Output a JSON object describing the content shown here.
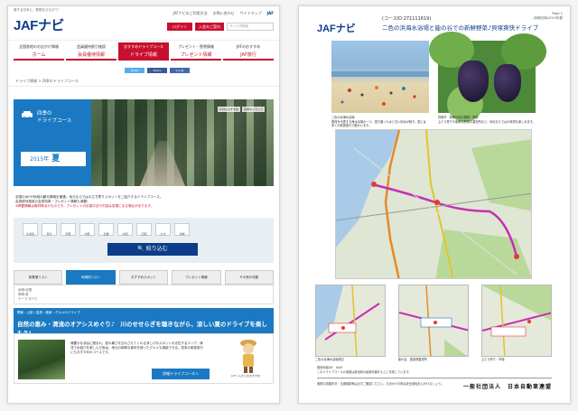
{
  "left": {
    "tagline": "旅する日本に、発見をひろげて!",
    "logo": "JAFナビ",
    "toplinks": [
      "JAFナビのご利用方法",
      "お問い合わせ",
      "サイトマップ",
      "JAF"
    ],
    "login": "ログイン",
    "member": "入会のご案内",
    "search_placeholder": "サイト内検索",
    "nav": [
      {
        "small": "全国各地のお出かけ情報",
        "big": "ホーム"
      },
      {
        "small": "会員優待割引施設",
        "big": "会員優待情報"
      },
      {
        "small": "おすすめドライブコース",
        "big": "ドライブ情報"
      },
      {
        "small": "プレゼント・懸賞情報",
        "big": "プレゼント情報"
      },
      {
        "small": "JAFのおすすめ",
        "big": "JAF旅行"
      }
    ],
    "social": [
      "Tweet",
      "Share",
      "いいね"
    ],
    "breadcrumb": "ドライブ情報 > 四季のドライブコース",
    "hero_title_1": "四季の",
    "hero_title_2": "ドライブコース",
    "hero_tags": [
      "[TOP] おすすめ",
      "四季のドライブ"
    ],
    "season_year": "2015年",
    "season_name": "夏",
    "desc_line1": "全国のJAFが地域の観光情報を厳選。地元ならではの立ち寄りスポットをご紹介するドライブコース。",
    "desc_line2": "会員優待施設の会員特典・プレゼント情報も満載!",
    "desc_line3": "※掲載情報は取材時点のものです。プレゼントの応募方法や内容は変更になる場合があります。",
    "regions": [
      "北海道",
      "東北",
      "関東",
      "中部",
      "近畿",
      "中国",
      "四国",
      "九州",
      "沖縄"
    ],
    "filter_btn": "絞り込む",
    "tabs": [
      "新着順リスト",
      "地域別リスト",
      "おすすめスポット",
      "プレゼント情報",
      "その他の特集"
    ],
    "meta": [
      "地域:全国",
      "季節:夏",
      "テーマ:すべて"
    ],
    "course_sub": "関東・山梨 | 温泉・絶景・グルメのドライブ",
    "course_title": "自然の恵み・清流のオアシスめぐり♪　川のせせらぎを聴きながら、涼しい夏のドライブを楽しもう!",
    "course_text": "緑豊かな渓谷に囲まれ、夏の暑さを忘れさせてくれる涼しげなスポットが点在するエリア。清流で水遊びを楽しんだ後は、地元の新鮮な食材を使ったグルメも堪能できる。週末の家族旅行にもおすすめのコースです。",
    "detail_btn": "詳細ドライブコースへ",
    "mascot_caption": "JAFくんからのおすすめ"
  },
  "right": {
    "logo": "JAFナビ",
    "course_id": "(コースID:271111619)",
    "title": "二色の浜海水浴場と能の谷での新鮮野菜♪貝塚爽快ドライブ",
    "page_info": [
      "Page 1",
      "(印刷日時)2015年夏"
    ],
    "photo1_caption": "二色の浜海水浴場\n関西を代表する海水浴場の一つ。透き通った水と白い砂浜が続き、夏には多くの家族連れで賑わいます。",
    "photo2_caption": "貝塚市　新鮮な旬の果物・野菜\nぶどう狩りや新鮮な野菜の直売所など、地元ならではの味覚を楽しめます。",
    "mini_captions": [
      "二色の浜海水浴場周辺",
      "能の谷　農産物直売所",
      "ぶどう狩り・市場"
    ],
    "footer1": "関西地域JAF　※JAF\nこのドライブコースの地図は各地域の最新情報をもとに作成しています。",
    "footer2": "実際の道路状況・交通規制等は必ずご確認ください。お出かけの際は安全運転を心がけましょう。",
    "org": "一般社団法人　日本自動車連盟"
  },
  "colors": {
    "jaf_red": "#c8102e",
    "jaf_blue": "#0c3c8a",
    "hero_blue": "#1a79c2"
  }
}
